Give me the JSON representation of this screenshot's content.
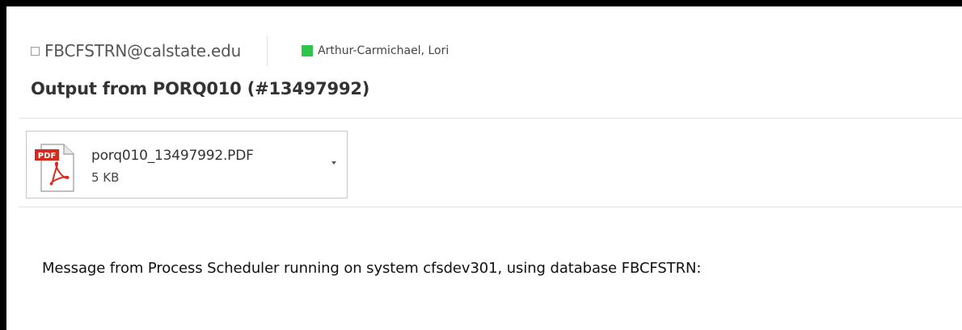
{
  "header": {
    "sender_email": "FBCFSTRN@calstate.edu",
    "recipient": "Arthur-Carmichael, Lori",
    "presence_color": "#2fc44c"
  },
  "subject": "Output from PORQ010 (#13497992)",
  "attachment": {
    "icon": "pdf-icon",
    "icon_badge": "PDF",
    "filename": "porq010_13497992.PDF",
    "size": "5 KB"
  },
  "body": {
    "text": "Message from Process Scheduler running on system cfsdev301, using database FBCFSTRN:"
  }
}
